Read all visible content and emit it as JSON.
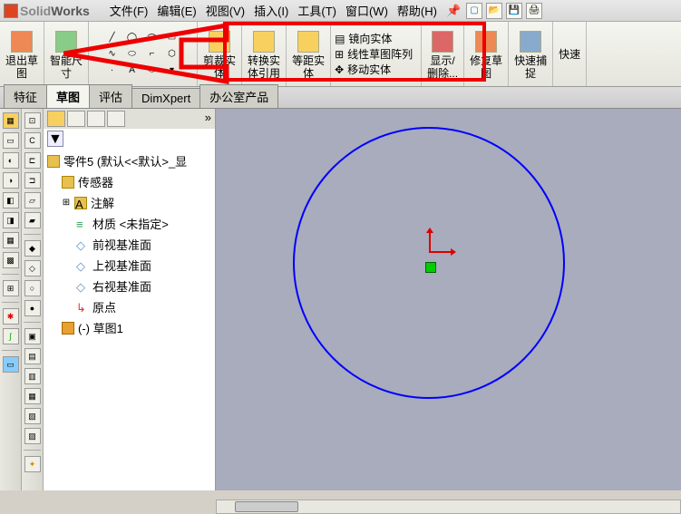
{
  "app": {
    "name_prefix": "Solid",
    "name_bold": "Works"
  },
  "menu": [
    "文件(F)",
    "编辑(E)",
    "视图(V)",
    "插入(I)",
    "工具(T)",
    "窗口(W)",
    "帮助(H)"
  ],
  "ribbon": {
    "exit_sketch": "退出草\n图",
    "smart_dim": "智能尺\n寸",
    "trim": "剪裁实\n体",
    "convert": "转换实\n体引用",
    "offset": "等距实\n体",
    "mirror": "镜向实体",
    "linear_pattern": "线性草图阵列",
    "move": "移动实体",
    "show_del": "显示/\n删除...",
    "repair": "修复草\n图",
    "quick_snap": "快速捕\n捉",
    "quick": "快速"
  },
  "tabs": [
    "特征",
    "草图",
    "评估",
    "DimXpert",
    "办公室产品"
  ],
  "tree": {
    "root": "零件5  (默认<<默认>_显",
    "items": [
      {
        "label": "传感器",
        "icon": "folder-icon",
        "color": "#e8c050"
      },
      {
        "label": "注解",
        "icon": "annotation-icon",
        "color": "#e8c050"
      },
      {
        "label": "材质 <未指定>",
        "icon": "material-icon",
        "color": "#30a060"
      },
      {
        "label": "前视基准面",
        "icon": "plane-icon",
        "color": "#6090c0"
      },
      {
        "label": "上视基准面",
        "icon": "plane-icon",
        "color": "#6090c0"
      },
      {
        "label": "右视基准面",
        "icon": "plane-icon",
        "color": "#6090c0"
      },
      {
        "label": "原点",
        "icon": "origin-icon",
        "color": "#d04040"
      },
      {
        "label": "(-) 草图1",
        "icon": "sketch-icon",
        "color": "#e8a030"
      }
    ]
  }
}
